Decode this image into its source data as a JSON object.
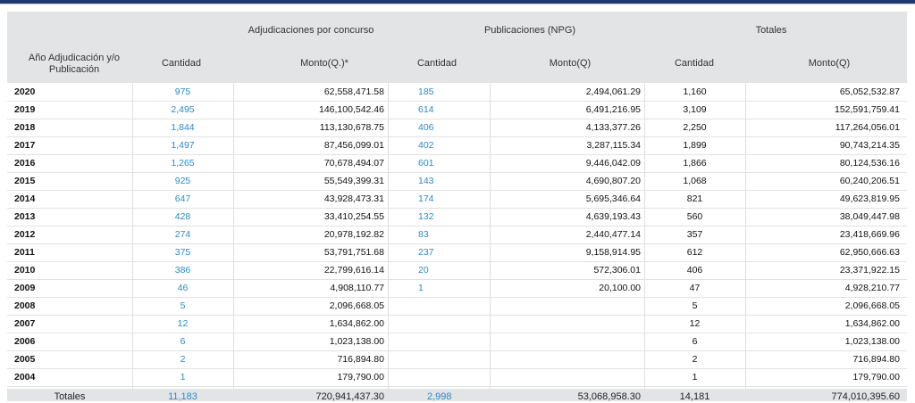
{
  "header": {
    "group_adj": "Adjudicaciones por concurso",
    "group_pub": "Publicaciones (NPG)",
    "group_tot": "Totales",
    "year_col_line1": "Año Adjudicación y/o",
    "year_col_line2": "Publicación",
    "cantidad_adj": "Cantidad",
    "monto_adj": "Monto(Q.)*",
    "cantidad_pub": "Cantidad",
    "monto_pub": "Monto(Q)",
    "cantidad_tot": "Cantidad",
    "monto_tot": "Monto(Q)"
  },
  "rows": [
    {
      "year": "2020",
      "q1": "975",
      "m1": "62,558,471.58",
      "q2": "185",
      "m2": "2,494,061.29",
      "q3": "1,160",
      "m3": "65,052,532.87"
    },
    {
      "year": "2019",
      "q1": "2,495",
      "m1": "146,100,542.46",
      "q2": "614",
      "m2": "6,491,216.95",
      "q3": "3,109",
      "m3": "152,591,759.41"
    },
    {
      "year": "2018",
      "q1": "1,844",
      "m1": "113,130,678.75",
      "q2": "406",
      "m2": "4,133,377.26",
      "q3": "2,250",
      "m3": "117,264,056.01"
    },
    {
      "year": "2017",
      "q1": "1,497",
      "m1": "87,456,099.01",
      "q2": "402",
      "m2": "3,287,115.34",
      "q3": "1,899",
      "m3": "90,743,214.35"
    },
    {
      "year": "2016",
      "q1": "1,265",
      "m1": "70,678,494.07",
      "q2": "601",
      "m2": "9,446,042.09",
      "q3": "1,866",
      "m3": "80,124,536.16"
    },
    {
      "year": "2015",
      "q1": "925",
      "m1": "55,549,399.31",
      "q2": "143",
      "m2": "4,690,807.20",
      "q3": "1,068",
      "m3": "60,240,206.51"
    },
    {
      "year": "2014",
      "q1": "647",
      "m1": "43,928,473.31",
      "q2": "174",
      "m2": "5,695,346.64",
      "q3": "821",
      "m3": "49,623,819.95"
    },
    {
      "year": "2013",
      "q1": "428",
      "m1": "33,410,254.55",
      "q2": "132",
      "m2": "4,639,193.43",
      "q3": "560",
      "m3": "38,049,447.98"
    },
    {
      "year": "2012",
      "q1": "274",
      "m1": "20,978,192.82",
      "q2": "83",
      "m2": "2,440,477.14",
      "q3": "357",
      "m3": "23,418,669.96"
    },
    {
      "year": "2011",
      "q1": "375",
      "m1": "53,791,751.68",
      "q2": "237",
      "m2": "9,158,914.95",
      "q3": "612",
      "m3": "62,950,666.63"
    },
    {
      "year": "2010",
      "q1": "386",
      "m1": "22,799,616.14",
      "q2": "20",
      "m2": "572,306.01",
      "q3": "406",
      "m3": "23,371,922.15"
    },
    {
      "year": "2009",
      "q1": "46",
      "m1": "4,908,110.77",
      "q2": "1",
      "m2": "20,100.00",
      "q3": "47",
      "m3": "4,928,210.77"
    },
    {
      "year": "2008",
      "q1": "5",
      "m1": "2,096,668.05",
      "q2": "",
      "m2": "",
      "q3": "5",
      "m3": "2,096,668.05"
    },
    {
      "year": "2007",
      "q1": "12",
      "m1": "1,634,862.00",
      "q2": "",
      "m2": "",
      "q3": "12",
      "m3": "1,634,862.00"
    },
    {
      "year": "2006",
      "q1": "6",
      "m1": "1,023,138.00",
      "q2": "",
      "m2": "",
      "q3": "6",
      "m3": "1,023,138.00"
    },
    {
      "year": "2005",
      "q1": "2",
      "m1": "716,894.80",
      "q2": "",
      "m2": "",
      "q3": "2",
      "m3": "716,894.80"
    },
    {
      "year": "2004",
      "q1": "1",
      "m1": "179,790.00",
      "q2": "",
      "m2": "",
      "q3": "1",
      "m3": "179,790.00"
    }
  ],
  "totals": {
    "label": "Totales",
    "q1": "11,183",
    "m1": "720,941,437.30",
    "q2": "2,998",
    "m2": "53,068,958.30",
    "q3": "14,181",
    "m3": "774,010,395.60"
  },
  "colors": {
    "accent_bar": "#1f3a72",
    "link_blue": "#2a8ac7",
    "header_bg": "#e3e4e6"
  }
}
